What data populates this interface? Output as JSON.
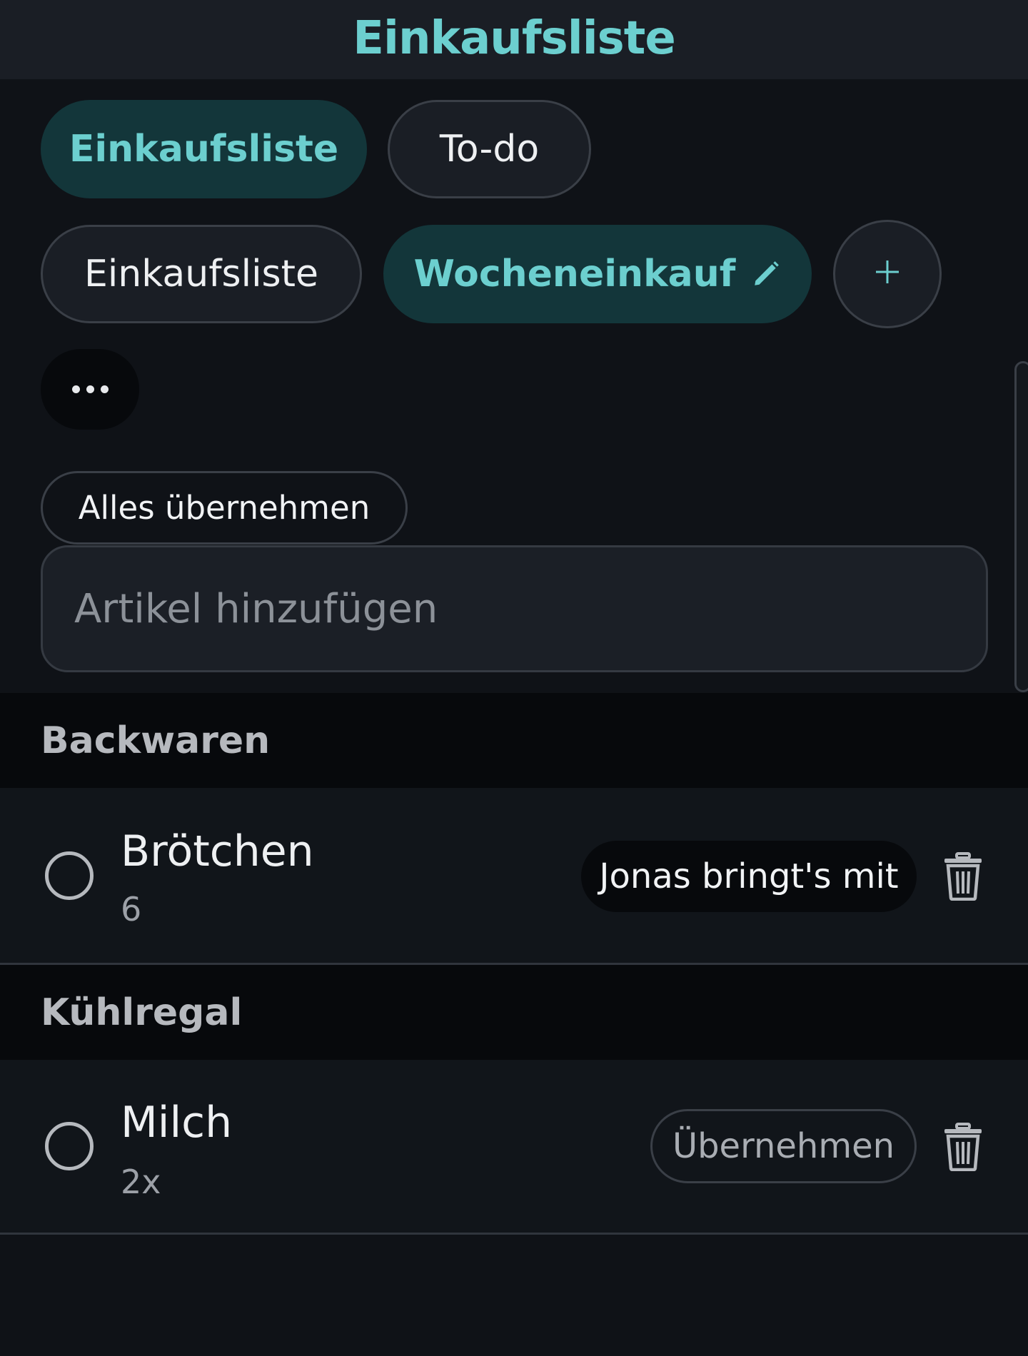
{
  "header": {
    "title": "Einkaufsliste"
  },
  "tabs": [
    {
      "label": "Einkaufsliste",
      "active": true
    },
    {
      "label": "To-do",
      "active": false
    }
  ],
  "lists": [
    {
      "label": "Einkaufsliste",
      "active": false
    },
    {
      "label": "Wocheneinkauf",
      "active": true
    }
  ],
  "icons": {
    "edit": "pencil-icon",
    "add": "plus-icon",
    "more": "more-horizontal-icon",
    "delete": "trash-icon",
    "check": "circle-checkbox-icon"
  },
  "actions": {
    "add_list_label": "+",
    "accept_all_label": "Alles übernehmen"
  },
  "add_item": {
    "placeholder": "Artikel hinzufügen",
    "value": ""
  },
  "categories": [
    {
      "name": "Backwaren",
      "items": [
        {
          "name": "Brötchen",
          "quantity": "6",
          "badge": "Jonas bringt's mit",
          "checked": false
        }
      ]
    },
    {
      "name": "Kühlregal",
      "items": [
        {
          "name": "Milch",
          "quantity": "2x",
          "action_label": "Übernehmen",
          "checked": false
        }
      ]
    }
  ],
  "colors": {
    "accent": "#6ccfcf",
    "active_pill_bg": "#13363a",
    "background": "#0f1217",
    "surface": "#1a1e25",
    "header_band": "#07090c"
  }
}
